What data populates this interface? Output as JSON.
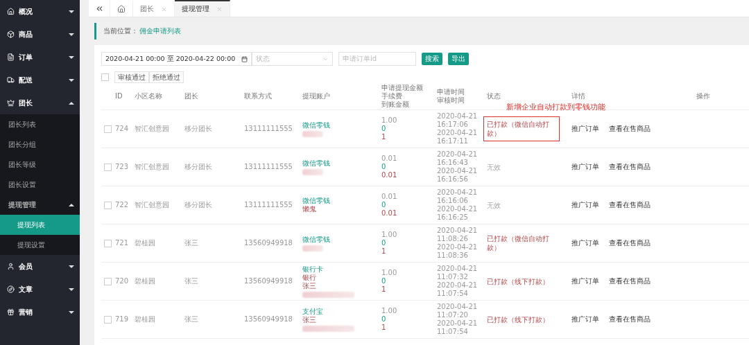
{
  "sidebar": {
    "items": [
      {
        "label": "概况",
        "kind": "home",
        "expanded": false
      },
      {
        "label": "商品",
        "kind": "box",
        "expanded": false
      },
      {
        "label": "订单",
        "kind": "file",
        "expanded": false
      },
      {
        "label": "配送",
        "kind": "truck",
        "expanded": false
      },
      {
        "label": "团长",
        "kind": "crown",
        "expanded": true,
        "children": [
          {
            "label": "团长列表",
            "selected": false
          },
          {
            "label": "团长分组",
            "selected": false
          },
          {
            "label": "团长等级",
            "selected": false
          },
          {
            "label": "团长设置",
            "selected": false
          },
          {
            "label": "提现管理",
            "selected": false,
            "expanded": true,
            "children": [
              {
                "label": "提现列表",
                "selected": true
              },
              {
                "label": "提现设置",
                "selected": false
              }
            ]
          }
        ]
      },
      {
        "label": "会员",
        "kind": "user",
        "expanded": false
      },
      {
        "label": "文章",
        "kind": "compass",
        "expanded": false
      },
      {
        "label": "营销",
        "kind": "gift",
        "expanded": false
      }
    ]
  },
  "tabs": [
    {
      "kind": "home",
      "selected": false
    },
    {
      "kind": "page",
      "label": "团长",
      "selected": false
    },
    {
      "kind": "page",
      "label": "提现管理",
      "selected": true
    }
  ],
  "breadcrumb": {
    "label": "当前位置：",
    "current": "佣金申请列表"
  },
  "filters": {
    "date_range": "2020-04-21 00:00 至 2020-04-22 00:00",
    "status_placeholder": "状态",
    "order_placeholder": "申请订单id",
    "buttons": [
      "搜索",
      "导出"
    ]
  },
  "batch": {
    "checked": false,
    "buttons": [
      "审核通过",
      "拒绝通过"
    ]
  },
  "annotation": "新增企业自动打款到零钱功能",
  "table": {
    "columns": [
      [
        "ID"
      ],
      [
        "小区名称"
      ],
      [
        "团长"
      ],
      [
        "联系方式"
      ],
      [
        "提现账户"
      ],
      [
        "申请提现金额",
        "手续费",
        "到账金额"
      ],
      [
        "申请时间",
        "审核时间"
      ],
      [
        "状态"
      ],
      [
        "详情"
      ],
      [
        "操作"
      ]
    ],
    "rows": [
      {
        "checked": false,
        "id": "724",
        "community": "智汇创意园",
        "leader": "移分团长",
        "phone": "13111111555",
        "account": [
          {
            "kind": "type",
            "text": "微信零钱"
          },
          {
            "kind": "blur"
          }
        ],
        "amount": "1.00",
        "fee": "0",
        "received": "1",
        "times": [
          "2020-04-21",
          "16:17:06",
          "2020-04-21",
          "16:17:11"
        ],
        "status": {
          "kind": "paid",
          "text": "已打款（微信自动打款）",
          "highlighted": true
        },
        "details": [
          "推广订单",
          "查看在售商品"
        ]
      },
      {
        "checked": false,
        "id": "723",
        "community": "智汇创意园",
        "leader": "移分团长",
        "phone": "13111111555",
        "account": [
          {
            "kind": "type",
            "text": "微信零钱"
          },
          {
            "kind": "blur"
          }
        ],
        "amount": "0.01",
        "fee": "0",
        "received": "0.01",
        "times": [
          "2020-04-21",
          "16:16:43",
          "2020-04-21",
          "16:16:56"
        ],
        "status": {
          "kind": "invalid",
          "text": "无效",
          "highlighted": false
        },
        "details": [
          "推广订单",
          "查看在售商品"
        ]
      },
      {
        "checked": false,
        "id": "722",
        "community": "智汇创意园",
        "leader": "移分团长",
        "phone": "13111111555",
        "account": [
          {
            "kind": "type",
            "text": "微信零钱"
          },
          {
            "kind": "name",
            "text": "懒鬼"
          }
        ],
        "amount": "0.01",
        "fee": "0",
        "received": "0.01",
        "times": [
          "2020-04-21",
          "16:16:06",
          "2020-04-21",
          "16:16:25"
        ],
        "status": {
          "kind": "invalid",
          "text": "无效",
          "highlighted": false
        },
        "details": [
          "推广订单",
          "查看在售商品"
        ]
      },
      {
        "checked": false,
        "id": "721",
        "community": "碧桂园",
        "leader": "张三",
        "phone": "13560949918",
        "account": [
          {
            "kind": "type",
            "text": "微信零钱"
          },
          {
            "kind": "blur"
          }
        ],
        "amount": "1.00",
        "fee": "0",
        "received": "1",
        "times": [
          "2020-04-21",
          "11:08:26",
          "2020-04-21",
          "11:08:36"
        ],
        "status": {
          "kind": "paid",
          "text": "已打款（微信自动打款）",
          "highlighted": false
        },
        "details": [
          "推广订单",
          "查看在售商品"
        ]
      },
      {
        "checked": false,
        "id": "720",
        "community": "碧桂园",
        "leader": "张三",
        "phone": "13560949918",
        "account": [
          {
            "kind": "type",
            "text": "银行卡"
          },
          {
            "kind": "name",
            "text": "银行"
          },
          {
            "kind": "name",
            "text": "张三"
          },
          {
            "kind": "blur"
          }
        ],
        "amount": "1.00",
        "fee": "0",
        "received": "1",
        "times": [
          "2020-04-21",
          "11:07:32",
          "2020-04-21",
          "11:07:54"
        ],
        "status": {
          "kind": "paid",
          "text": "已打款（线下打款）",
          "highlighted": false
        },
        "details": [
          "推广订单",
          "查看在售商品"
        ]
      },
      {
        "checked": false,
        "id": "719",
        "community": "碧桂园",
        "leader": "张三",
        "phone": "13560949918",
        "account": [
          {
            "kind": "type",
            "text": "支付宝"
          },
          {
            "kind": "name",
            "text": "张三"
          },
          {
            "kind": "blur"
          }
        ],
        "amount": "1.00",
        "fee": "0",
        "received": "1",
        "times": [
          "2020-04-21",
          "11:07:20",
          "2020-04-21",
          "11:07:54"
        ],
        "status": {
          "kind": "paid",
          "text": "已打款（线下打款）",
          "highlighted": false
        },
        "details": [
          "推广订单",
          "查看在售商品"
        ]
      }
    ]
  }
}
